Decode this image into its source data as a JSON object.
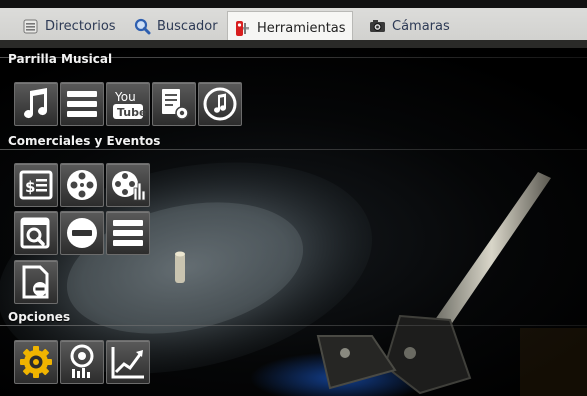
{
  "tabs": [
    {
      "label": "Directorios",
      "icon": "folder-icon",
      "active": false
    },
    {
      "label": "Buscador",
      "icon": "magnifier-icon",
      "active": false
    },
    {
      "label": "Herramientas",
      "icon": "tools-icon",
      "active": true
    },
    {
      "label": "Cámaras",
      "icon": "camera-icon",
      "active": false
    }
  ],
  "sections": {
    "music": {
      "title": "Parrilla Musical",
      "tools": [
        "music-note-icon",
        "list-icon",
        "youtube-icon",
        "settings-document-icon",
        "music-disc-icon"
      ]
    },
    "commercials": {
      "title": "Comerciales y Eventos",
      "tools": [
        "price-list-icon",
        "reel-icon",
        "reel-stats-icon",
        "search-document-icon",
        "minus-circle-icon",
        "list-icon",
        "remove-document-icon"
      ]
    },
    "options": {
      "title": "Opciones",
      "tools": [
        "gear-icon",
        "eye-levels-icon",
        "line-chart-icon"
      ]
    }
  },
  "colors": {
    "tabbar": "#d4d4d1",
    "active_tab": "#f6f6f4",
    "tab_text": "#2d3a55",
    "section_text": "#f2f2f2",
    "accent_gear": "#f0b400"
  }
}
